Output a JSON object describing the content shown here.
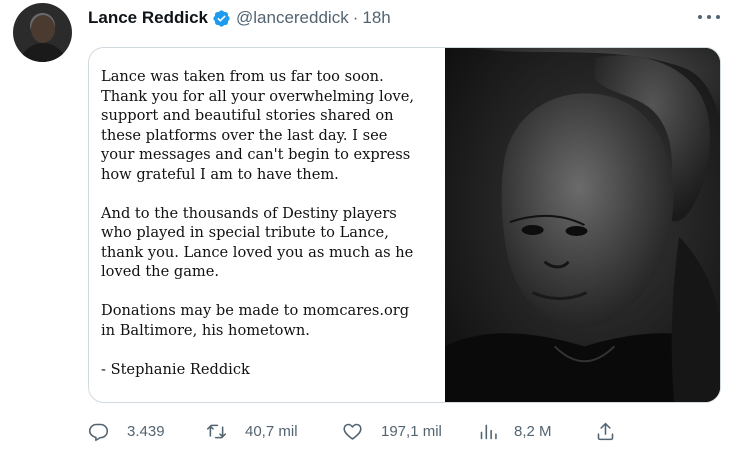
{
  "tweet": {
    "author_name": "Lance Reddick",
    "handle": "@lancereddick",
    "separator": "·",
    "time": "18h",
    "verified": true
  },
  "note": {
    "paragraphs": [
      [
        "Lance was taken from us far too soon.",
        "Thank you for all your overwhelming love,",
        "support and beautiful stories shared on",
        "these platforms over the last day. I see",
        "your messages and can't begin to express",
        "how grateful I am to have them."
      ],
      [
        "And to the thousands of Destiny players",
        "who played in special tribute to Lance,",
        "thank you. Lance loved you as much as he",
        "loved the game."
      ],
      [
        "Donations may be made to momcares.org",
        "in Baltimore, his hometown."
      ],
      [
        "- Stephanie Reddick"
      ]
    ]
  },
  "actions": {
    "replies": "3.439",
    "retweets": "40,7 mil",
    "likes": "197,1 mil",
    "views": "8,2 M"
  },
  "icons": {
    "verified": "verified-badge-icon",
    "more": "more-icon",
    "reply": "reply-icon",
    "retweet": "retweet-icon",
    "like": "heart-icon",
    "views": "views-icon",
    "share": "share-icon"
  },
  "colors": {
    "verified": "#1d9bf0",
    "text": "#0f1419",
    "secondary": "#536471",
    "border": "#cfd9de"
  }
}
